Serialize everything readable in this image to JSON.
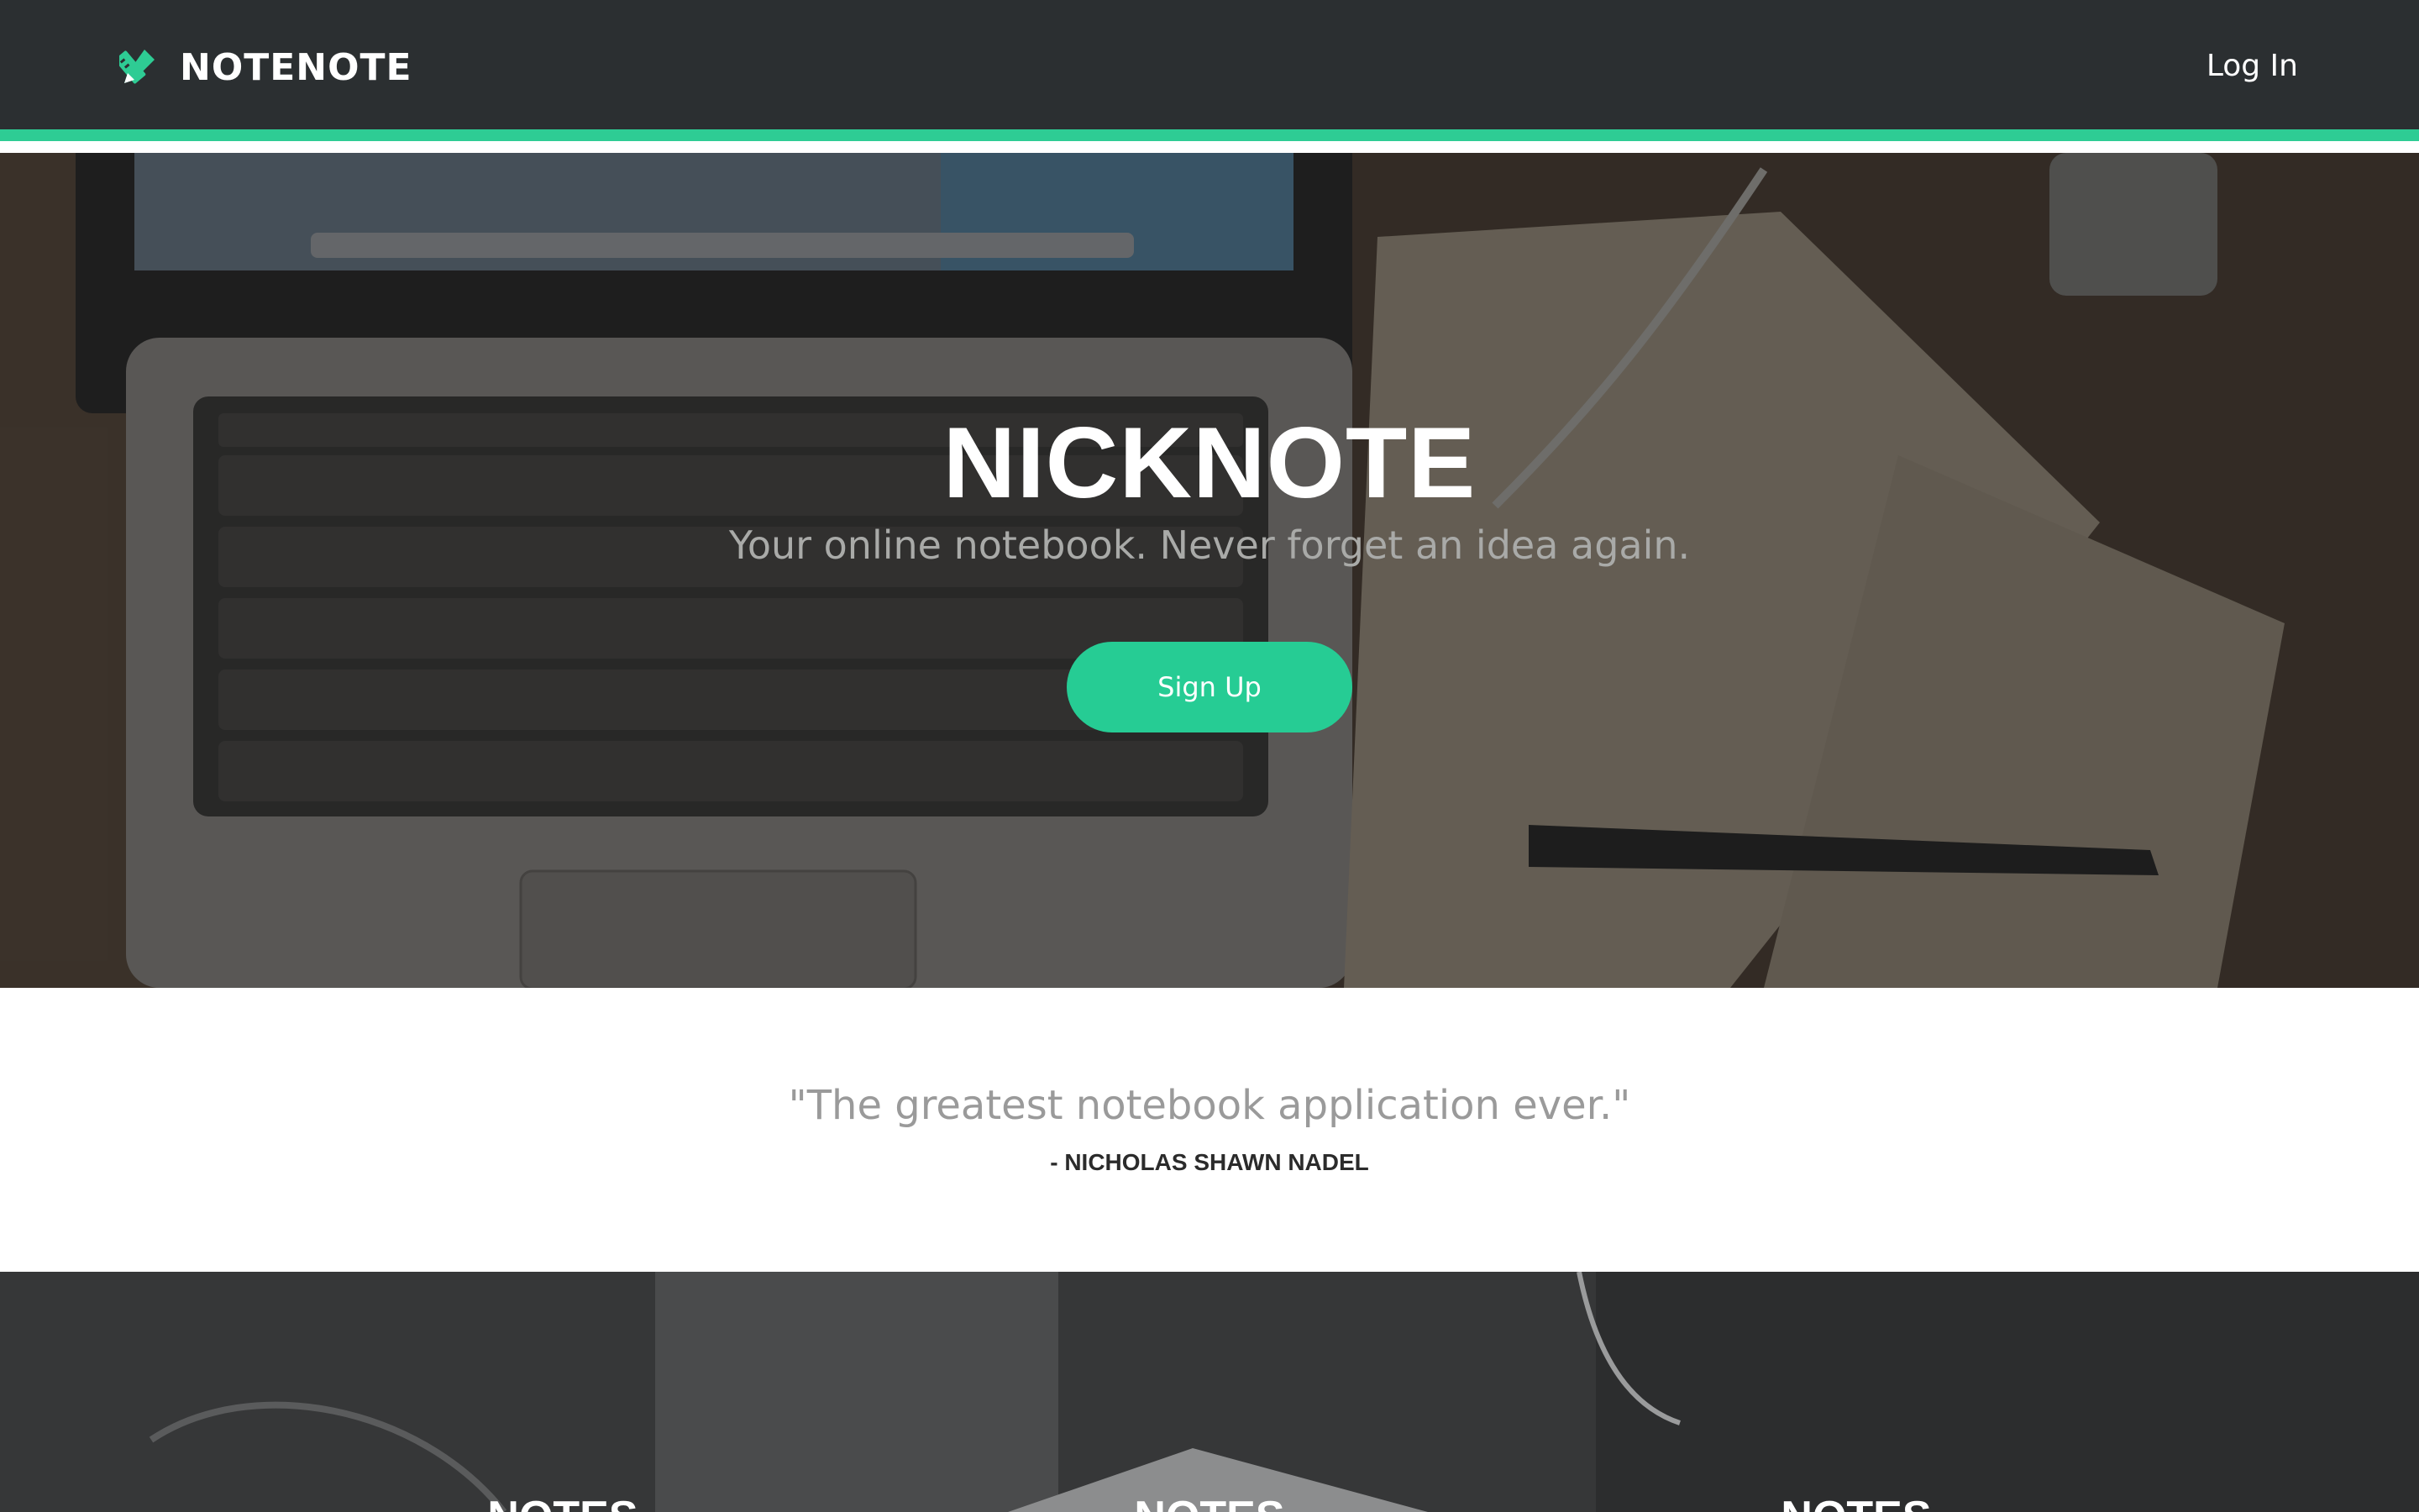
{
  "brand": {
    "name": "NOTENOTE",
    "icon": "pencil-ruler-icon",
    "accent_color": "#2ecc94"
  },
  "nav": {
    "login_label": "Log In"
  },
  "hero": {
    "title": "NICKNOTE",
    "tagline": "Your online notebook. Never forget an idea again.",
    "signup_label": "Sign Up",
    "background": "laptop-and-notebook-photo"
  },
  "testimonial": {
    "quote": "\"The greatest notebook application ever.\"",
    "author": "- NICHOLAS SHAWN NADEL"
  },
  "features": {
    "background": "desk-with-hand-photo",
    "headings": [
      "NOTES",
      "NOTES",
      "NOTES"
    ]
  }
}
